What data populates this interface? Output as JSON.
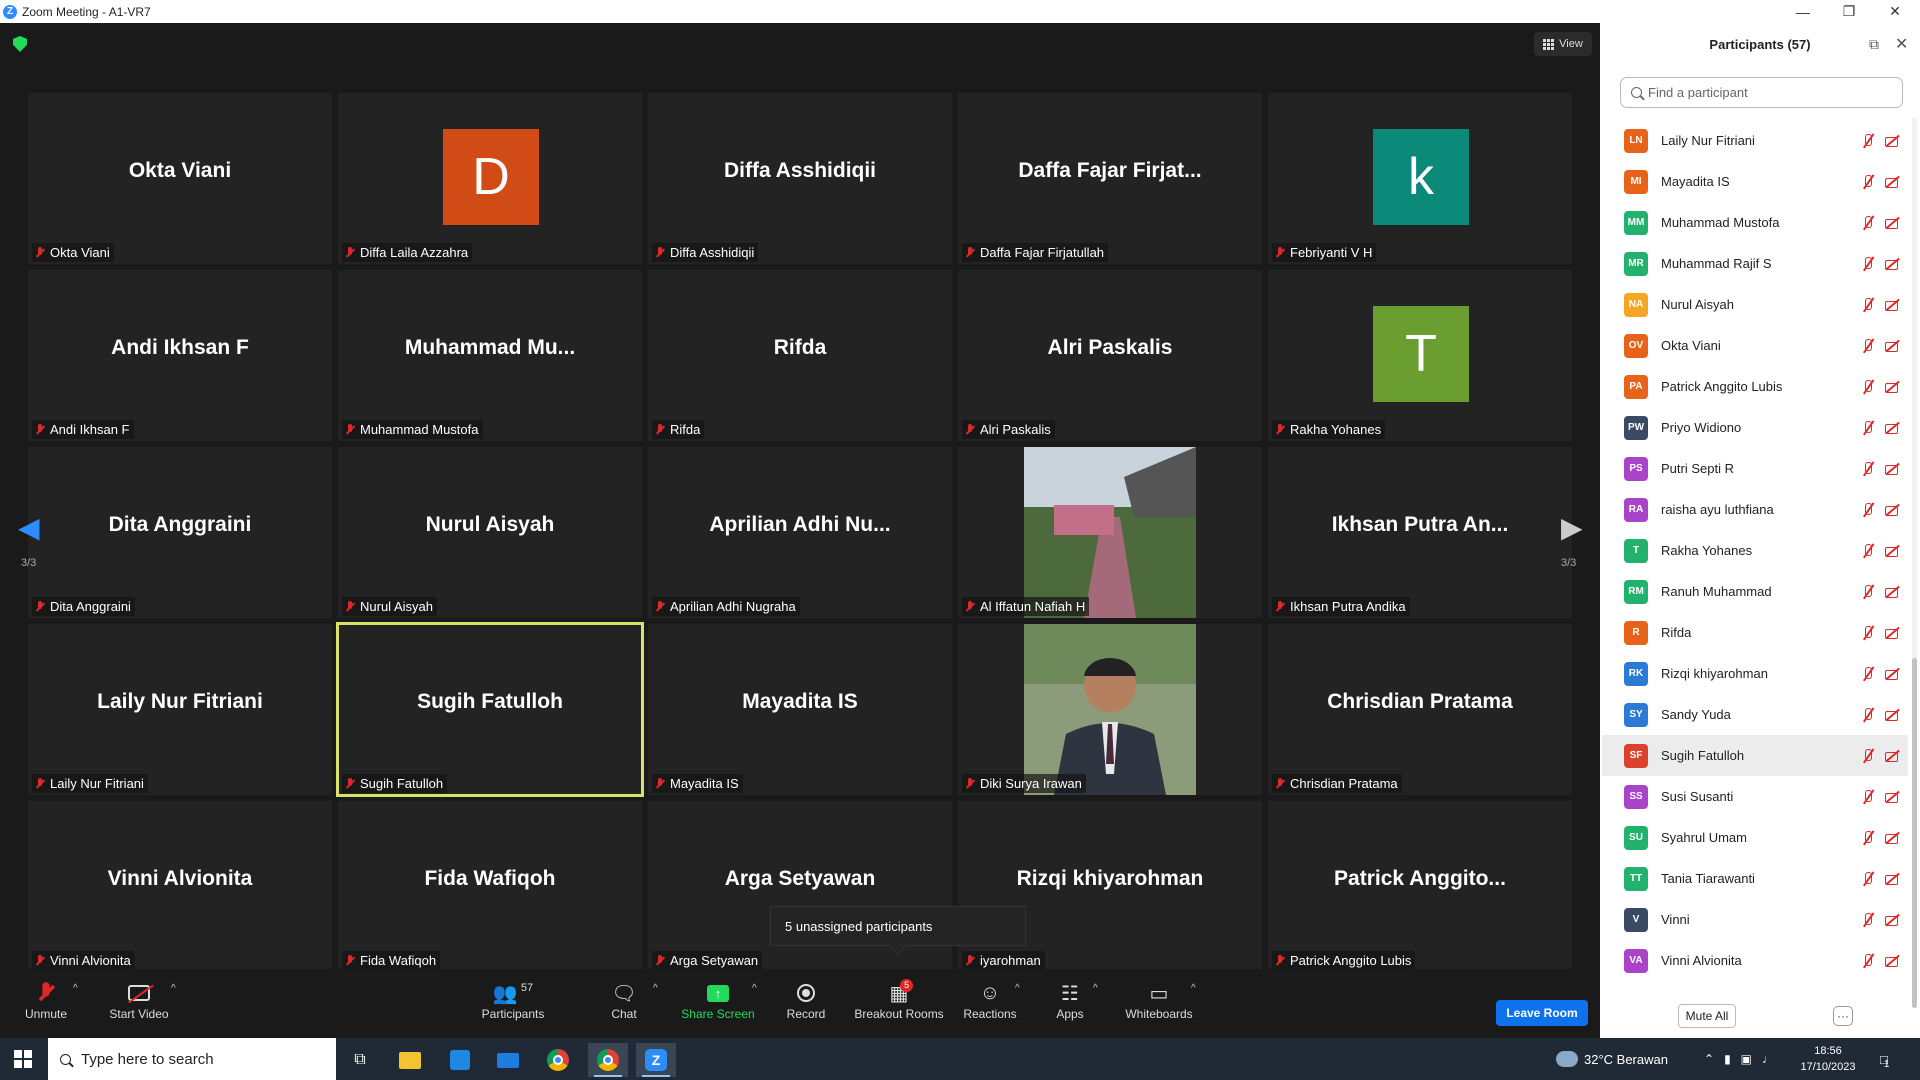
{
  "window": {
    "title": "Zoom Meeting - A1-VR7",
    "logo": "Z",
    "controls": [
      "minimize-icon",
      "restore-icon",
      "close-icon"
    ]
  },
  "header": {
    "view_label": "View"
  },
  "pager": {
    "left_label": "3/3",
    "right_label": "3/3"
  },
  "tiles": [
    {
      "big": "Okta Viani",
      "name": "Okta Viani"
    },
    {
      "big": "",
      "name": "Diffa Laila Azzahra",
      "avatar": "D",
      "avatar_color": "#d14b17"
    },
    {
      "big": "Diffa Asshidiqii",
      "name": "Diffa Asshidiqii"
    },
    {
      "big": "Daffa  Fajar  Firjat...",
      "name": "Daffa Fajar Firjatullah"
    },
    {
      "big": "",
      "name": "Febriyanti V H",
      "avatar": "k",
      "avatar_color": "#0b8a7a"
    },
    {
      "big": "Andi Ikhsan F",
      "name": "Andi Ikhsan F"
    },
    {
      "big": "Muhammad  Mu...",
      "name": "Muhammad Mustofa"
    },
    {
      "big": "Rifda",
      "name": "Rifda"
    },
    {
      "big": "Alri Paskalis",
      "name": "Alri Paskalis"
    },
    {
      "big": "",
      "name": "Rakha Yohanes",
      "avatar": "T",
      "avatar_color": "#6a9e31"
    },
    {
      "big": "Dita Anggraini",
      "name": "Dita Anggraini"
    },
    {
      "big": "Nurul Aisyah",
      "name": "Nurul Aisyah"
    },
    {
      "big": "Aprilian  Adhi  Nu...",
      "name": "Aprilian Adhi Nugraha"
    },
    {
      "big": "",
      "name": "Al Iffatun Nafiah H",
      "photo": "pier"
    },
    {
      "big": "Ikhsan  Putra  An...",
      "name": "Ikhsan Putra Andika"
    },
    {
      "big": "Laily Nur Fitriani",
      "name": "Laily Nur Fitriani"
    },
    {
      "big": "Sugih Fatulloh",
      "name": "Sugih Fatulloh",
      "active": true
    },
    {
      "big": "Mayadita IS",
      "name": "Mayadita IS"
    },
    {
      "big": "",
      "name": "Diki Surya Irawan",
      "photo": "man"
    },
    {
      "big": "Chrisdian Pratama",
      "name": "Chrisdian Pratama"
    },
    {
      "big": "Vinni Alvionita",
      "name": "Vinni Alvionita"
    },
    {
      "big": "Fida Wafiqoh",
      "name": "Fida Wafiqoh"
    },
    {
      "big": "Arga Setyawan",
      "name": "Arga Setyawan"
    },
    {
      "big": "Rizqi khiyarohman",
      "name": "iyarohman"
    },
    {
      "big": "Patrick  Anggito...",
      "name": "Patrick Anggito Lubis"
    }
  ],
  "toast": "5 unassigned participants",
  "toolbar": {
    "unmute": "Unmute",
    "start_video": "Start Video",
    "participants": "Participants",
    "participants_count": "57",
    "chat": "Chat",
    "share_screen": "Share Screen",
    "record": "Record",
    "breakout": "Breakout Rooms",
    "breakout_badge": "5",
    "reactions": "Reactions",
    "apps": "Apps",
    "whiteboards": "Whiteboards",
    "leave": "Leave Room"
  },
  "panel": {
    "title": "Participants (57)",
    "search_placeholder": "Find a participant",
    "mute_all": "Mute All",
    "more": "···",
    "participants": [
      {
        "initials": "LN",
        "name": "Laily Nur Fitriani",
        "color": "#e8631a"
      },
      {
        "initials": "MI",
        "name": "Mayadita IS",
        "color": "#e8631a"
      },
      {
        "initials": "MM",
        "name": "Muhammad Mustofa",
        "color": "#23b26d"
      },
      {
        "initials": "MR",
        "name": "Muhammad Rajif S",
        "color": "#23b26d"
      },
      {
        "initials": "NA",
        "name": "Nurul Aisyah",
        "color": "#f5a623"
      },
      {
        "initials": "OV",
        "name": "Okta Viani",
        "color": "#e8631a"
      },
      {
        "initials": "PA",
        "name": "Patrick Anggito Lubis",
        "color": "#e8631a"
      },
      {
        "initials": "PW",
        "name": "Priyo Widiono",
        "color": "#3b4a63"
      },
      {
        "initials": "PS",
        "name": "Putri Septi R",
        "color": "#a944c9"
      },
      {
        "initials": "RA",
        "name": "raisha ayu luthfiana",
        "color": "#a944c9"
      },
      {
        "initials": "T",
        "name": "Rakha Yohanes",
        "color": "#23b26d"
      },
      {
        "initials": "RM",
        "name": "Ranuh Muhammad",
        "color": "#23b26d"
      },
      {
        "initials": "R",
        "name": "Rifda",
        "color": "#e8631a"
      },
      {
        "initials": "RK",
        "name": "Rizqi khiyarohman",
        "color": "#2a7ad6"
      },
      {
        "initials": "SY",
        "name": "Sandy Yuda",
        "color": "#2a7ad6"
      },
      {
        "initials": "SF",
        "name": "Sugih Fatulloh",
        "color": "#d9422b",
        "selected": true
      },
      {
        "initials": "SS",
        "name": "Susi Susanti",
        "color": "#a944c9"
      },
      {
        "initials": "SU",
        "name": "Syahrul Umam",
        "color": "#23b26d"
      },
      {
        "initials": "TT",
        "name": "Tania Tiarawanti",
        "color": "#23b26d"
      },
      {
        "initials": "V",
        "name": "Vinni",
        "color": "#3b4a63"
      },
      {
        "initials": "VA",
        "name": "Vinni Alvionita",
        "color": "#a944c9"
      }
    ]
  },
  "taskbar": {
    "search_placeholder": "Type here to search",
    "weather": "32°C  Berawan",
    "time": "18:56",
    "date": "17/10/2023",
    "notification_count": "1"
  },
  "colors": {
    "accent": "#2d8cff",
    "muted": "#e02828",
    "share": "#23d959",
    "leave": "#0e72ed"
  }
}
